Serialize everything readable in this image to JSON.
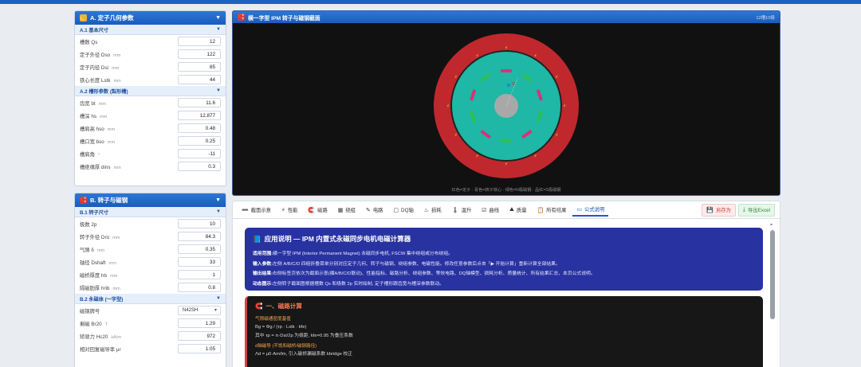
{
  "panel_a": {
    "title": "A. 定子几何参数",
    "section1": "A.1 基本尺寸",
    "rows1": [
      {
        "label": "槽数 Qs",
        "unit": "",
        "value": "12"
      },
      {
        "label": "定子外径 Dso",
        "unit": "mm",
        "value": "122"
      },
      {
        "label": "定子内径 Dsi",
        "unit": "mm",
        "value": "85"
      },
      {
        "label": "铁心长度 Lstk",
        "unit": "mm",
        "value": "44"
      }
    ],
    "section2": "A.2 槽形参数 (梨形槽)",
    "rows2": [
      {
        "label": "齿宽 bt",
        "unit": "mm",
        "value": "11.6"
      },
      {
        "label": "槽深 hs",
        "unit": "mm",
        "value": "12.877"
      },
      {
        "label": "槽肩高 hso",
        "unit": "mm",
        "value": "0.48"
      },
      {
        "label": "槽口宽 bso",
        "unit": "mm",
        "value": "0.25"
      },
      {
        "label": "槽肩角",
        "unit": "°",
        "value": "-11"
      },
      {
        "label": "槽绝缘厚 dins",
        "unit": "mm",
        "value": "0.3"
      }
    ]
  },
  "panel_b": {
    "title": "B. 转子与磁钢",
    "section1": "B.1 转子尺寸",
    "rows1": [
      {
        "label": "极数 2p",
        "unit": "",
        "value": "10"
      },
      {
        "label": "转子外径 Dro",
        "unit": "mm",
        "value": "84.3"
      },
      {
        "label": "气隙 δ",
        "unit": "mm",
        "value": "0.35"
      },
      {
        "label": "轴径 Dshaft",
        "unit": "mm",
        "value": "33"
      },
      {
        "label": "磁桥厚度 hb",
        "unit": "mm",
        "value": "1"
      },
      {
        "label": "隔磁肋厚 hrib",
        "unit": "mm",
        "value": "0.8"
      }
    ],
    "section2": "B.2 永磁体 (一字型)",
    "grade_label": "磁钢牌号",
    "grade_value": "N42SH",
    "rows2": [
      {
        "label": "剩磁 Br20",
        "unit": "T",
        "value": "1.29"
      },
      {
        "label": "矫顽力 Hc20",
        "unit": "kA/m",
        "value": "972"
      },
      {
        "label": "相对回复磁导率 μr",
        "unit": "",
        "value": "1.05"
      }
    ]
  },
  "viewer": {
    "title": "横一字型 IPM 转子与磁钢截面",
    "meta": "12槽10极",
    "caption": "红色=定子 · 青色=转子铁心 · 绿色=N极磁钢 · 品红=S极磁钢"
  },
  "tabs": [
    {
      "icon": "➖",
      "label": "截面示意"
    },
    {
      "icon": "⚡",
      "label": "性能"
    },
    {
      "icon": "🧲",
      "label": "磁路"
    },
    {
      "icon": "▦",
      "label": "绕组"
    },
    {
      "icon": "✎",
      "label": "电路"
    },
    {
      "icon": "▢",
      "label": "DQ轴"
    },
    {
      "icon": "♨",
      "label": "损耗"
    },
    {
      "icon": "🌡",
      "label": "温升"
    },
    {
      "icon": "☑",
      "label": "曲线"
    },
    {
      "icon": "⛰",
      "label": "质量"
    },
    {
      "icon": "📋",
      "label": "所有结果"
    },
    {
      "icon": "▭",
      "label": "公式说明"
    }
  ],
  "actions": {
    "save": "另存为",
    "export": "导出Excel"
  },
  "info": {
    "title": "应用说明 — IPM 内置式永磁同步电机电磁计算器",
    "lines": [
      {
        "key": "适用范围:",
        "text": "横一字型 IPM (Interior Permanent Magnet) 永磁同步电机, FSCW 集中绕组或分布绕组。"
      },
      {
        "key": "输入参数:",
        "text": "左侧 A/B/C/D 四组折叠菜单分别对应定子几何、转子与磁钢、绕组参数、电磁性能。修改任意参数后点击「▶ 开始计算」重新计算全部结果。"
      },
      {
        "key": "输出结果:",
        "text": "右侧标签页依次为截面示意(横A/B/C/D联动)、性能指标、磁路分析、绕组参数、等效电路、DQ轴模型、损耗分析、质量统计、所有结果汇总、本页公式说明。"
      },
      {
        "key": "动态图示:",
        "text": "左侧转子截面图根据槽数 Qs 和极数 2p 实时绘制, 定子槽形跟齿宽与槽深参数联动。"
      }
    ]
  },
  "calc": {
    "title": "一、磁路计算",
    "sec1": "气隙磁通密度基值",
    "f1": "Bg = Φg / (τp · Lstk · kfe)",
    "f2": "其中 τp = π·Dsi/2p 为极距, kfe=0.95 为叠压系数",
    "sec2": "d轴磁导 (不饱和磁桥/磁钢路径)",
    "f3": "Λd = μ0·Am/lm, 引入磁桥漏磁系数 kbridge 校正"
  },
  "colors": {
    "stator": "#c0282d",
    "rotor": "#1fb7a6",
    "shaft": "#a8a8a8",
    "magnet_n": "#2cbf55",
    "magnet_s": "#d6337a",
    "accent": "#1a5cbc"
  }
}
